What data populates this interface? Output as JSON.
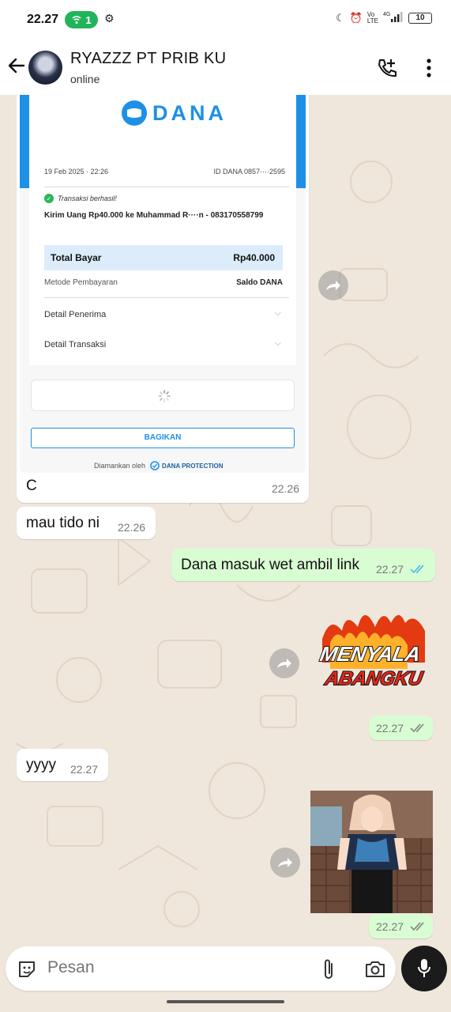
{
  "status_bar": {
    "time": "22.27",
    "hotspot_count": "1",
    "battery": "10",
    "network": "4G"
  },
  "header": {
    "contact_name": "RYAZZZ PT PRIB KU",
    "status": "online",
    "icons": [
      "back-arrow-icon",
      "add-call-icon",
      "more-vert-icon"
    ]
  },
  "receipt": {
    "brand": "DANA",
    "date": "19 Feb 2025 · 22:26",
    "dana_id": "ID DANA 0857····2595",
    "success_text": "Transaksi berhasil!",
    "description": "Kirim Uang Rp40.000 ke Muhammad R····n - 083170558799",
    "total_label": "Total Bayar",
    "total_value": "Rp40.000",
    "payment_method_label": "Metode Pembayaran",
    "payment_method_value": "Saldo DANA",
    "detail_recipient": "Detail Penerima",
    "detail_transaction": "Detail Transaksi",
    "share_button": "BAGIKAN",
    "secured_by": "Diamankan oleh",
    "protection": "DANA PROTECTION"
  },
  "messages": [
    {
      "direction": "in",
      "text": "C",
      "time": "22.26"
    },
    {
      "direction": "in",
      "text": "mau tido ni",
      "time": "22.26"
    },
    {
      "direction": "out",
      "text": "Dana masuk wet ambil link",
      "time": "22.27",
      "read": true
    },
    {
      "direction": "out",
      "type": "sticker",
      "sticker_text_1": "MENYALA",
      "sticker_text_2": "ABANGKU",
      "time": "22.27",
      "read": false
    },
    {
      "direction": "in",
      "text": "yyyy",
      "time": "22.27"
    },
    {
      "direction": "out",
      "type": "image",
      "time": "22.27",
      "read": false
    }
  ],
  "input": {
    "placeholder": "Pesan"
  },
  "colors": {
    "chat_bg": "#efe7dc",
    "outgoing_bubble": "#d9fdd3",
    "incoming_bubble": "#ffffff",
    "read_tick": "#53bdeb",
    "dana_blue": "#1e90e6"
  }
}
